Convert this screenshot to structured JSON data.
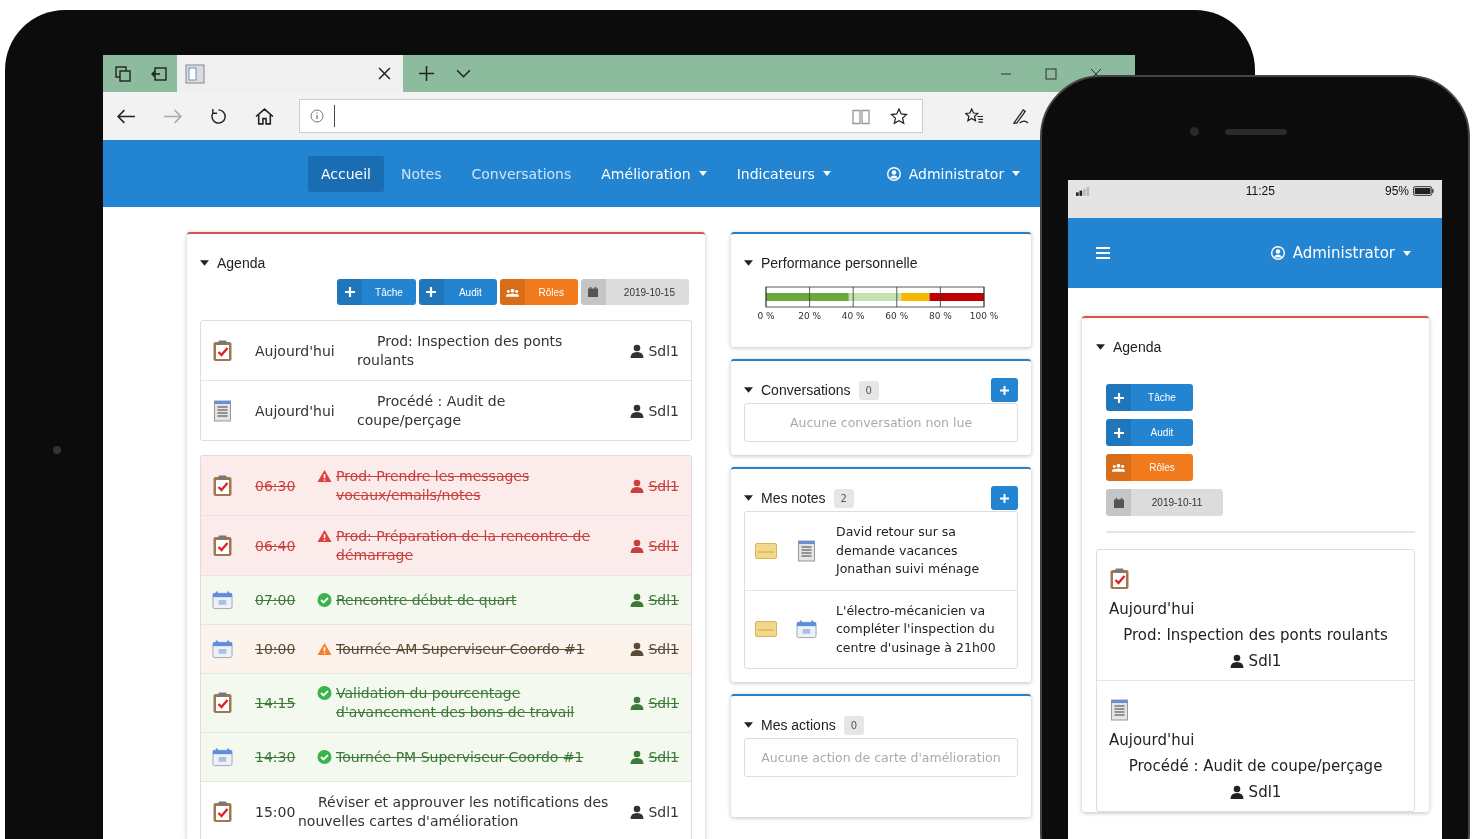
{
  "nav": {
    "items": [
      {
        "label": "Accueil",
        "selected": true,
        "dropdown": false
      },
      {
        "label": "Notes",
        "selected": false,
        "dropdown": false
      },
      {
        "label": "Conversations",
        "selected": false,
        "dropdown": false
      },
      {
        "label": "Amélioration",
        "selected": false,
        "dropdown": true
      },
      {
        "label": "Indicateurs",
        "selected": false,
        "dropdown": true
      }
    ],
    "user": "Administrator"
  },
  "agenda": {
    "title": "Agenda",
    "expanded": true,
    "buttons": [
      {
        "label": "Tâche",
        "kind": "add"
      },
      {
        "label": "Audit",
        "kind": "add"
      },
      {
        "label": "Rôles",
        "kind": "roles"
      },
      {
        "label": "2019-10-15",
        "kind": "date"
      }
    ],
    "today": [
      {
        "kind": "task",
        "when": "Aujourd'hui",
        "text": "Prod: Inspection des ponts roulants",
        "user": "Sdl1"
      },
      {
        "kind": "audit",
        "when": "Aujourd'hui",
        "text": "Procédé : Audit de coupe/perçage",
        "user": "Sdl1"
      }
    ],
    "schedule": [
      {
        "kind": "task",
        "when": "06:30",
        "overdue": true,
        "completed": false,
        "color": "#e0403c",
        "crossed_out": true,
        "text": "Prod: Prendre les messages vocaux/emails/notes",
        "user": "Sdl1"
      },
      {
        "kind": "task",
        "when": "06:40",
        "overdue": true,
        "completed": false,
        "color": "#e0403c",
        "crossed_out": true,
        "text": "Prod: Préparation de la rencontre de démarrage",
        "user": "Sdl1"
      },
      {
        "kind": "meeting",
        "when": "07:00",
        "overdue": false,
        "completed": true,
        "color": "#3bb34a",
        "crossed_out": true,
        "text": "Rencontre début de quart",
        "user": "Sdl1"
      },
      {
        "kind": "meeting",
        "when": "10:00",
        "overdue": false,
        "completed": false,
        "color": "#f5802a",
        "crossed_out": true,
        "text": "Tournée AM Superviseur-Coordo #1",
        "user": "Sdl1"
      },
      {
        "kind": "task",
        "when": "14:15",
        "overdue": false,
        "completed": true,
        "color": "#3bb34a",
        "crossed_out": true,
        "text": "Validation du pourcentage d'avancement des bons de travail",
        "user": "Sdl1"
      },
      {
        "kind": "meeting",
        "when": "14:30",
        "overdue": false,
        "completed": true,
        "color": "#3bb34a",
        "crossed_out": true,
        "text": "Tournée PM Superviseur-Coordo #1",
        "user": "Sdl1"
      },
      {
        "kind": "task",
        "when": "15:00",
        "overdue": false,
        "completed": false,
        "crossed_out": false,
        "text": "Réviser et approuver les notifications des nouvelles cartes d'amélioration",
        "user": "Sdl1"
      }
    ]
  },
  "performance": {
    "title": "Performance personnelle",
    "expanded": true,
    "chart_data": {
      "type": "bar",
      "orientation": "horizontal",
      "stacked": true,
      "grid": true,
      "xlim": [
        0,
        100
      ],
      "xticks": [
        {
          "value": 0,
          "label": "0 %"
        },
        {
          "value": 20,
          "label": "20 %"
        },
        {
          "value": 40,
          "label": "40 %"
        },
        {
          "value": 60,
          "label": "60 %"
        },
        {
          "value": 80,
          "label": "80 %"
        },
        {
          "value": 100,
          "label": "100 %"
        }
      ],
      "series": [
        {
          "color": "#6aaa3c",
          "values": [
            38
          ]
        },
        {
          "color": "#c5e2b0",
          "values": [
            24
          ]
        },
        {
          "color": "#f5b800",
          "values": [
            13
          ]
        },
        {
          "color": "#c00000",
          "values": [
            25
          ]
        }
      ]
    }
  },
  "conversations": {
    "title": "Conversations",
    "expanded": true,
    "count": "0",
    "empty": "Aucune conversation non lue"
  },
  "notes": {
    "title": "Mes notes",
    "expanded": true,
    "count": "2",
    "items": [
      {
        "kind": "audit",
        "text": "David retour sur sa demande vacances Jonathan suivi ménage"
      },
      {
        "kind": "meeting",
        "text": "L'électro-mécanicien va compléter l'inspection du centre d'usinage à 21h00"
      }
    ]
  },
  "actions": {
    "title": "Mes actions",
    "expanded": true,
    "count": "0",
    "empty": "Aucune action de carte d'amélioration"
  },
  "phone": {
    "time": "11:25",
    "battery": "95%",
    "user": "Administrator",
    "agenda_title": "Agenda",
    "expanded": true,
    "buttons": [
      {
        "label": "Tâche",
        "kind": "add"
      },
      {
        "label": "Audit",
        "kind": "add"
      },
      {
        "label": "Rôles",
        "kind": "roles"
      },
      {
        "label": "2019-10-11",
        "kind": "date"
      }
    ],
    "items": [
      {
        "kind": "task",
        "when": "Aujourd'hui",
        "text": "Prod: Inspection des ponts roulants",
        "user": "Sdl1"
      },
      {
        "kind": "audit",
        "when": "Aujourd'hui",
        "text": "Procédé : Audit de coupe/perçage",
        "user": "Sdl1"
      }
    ]
  }
}
